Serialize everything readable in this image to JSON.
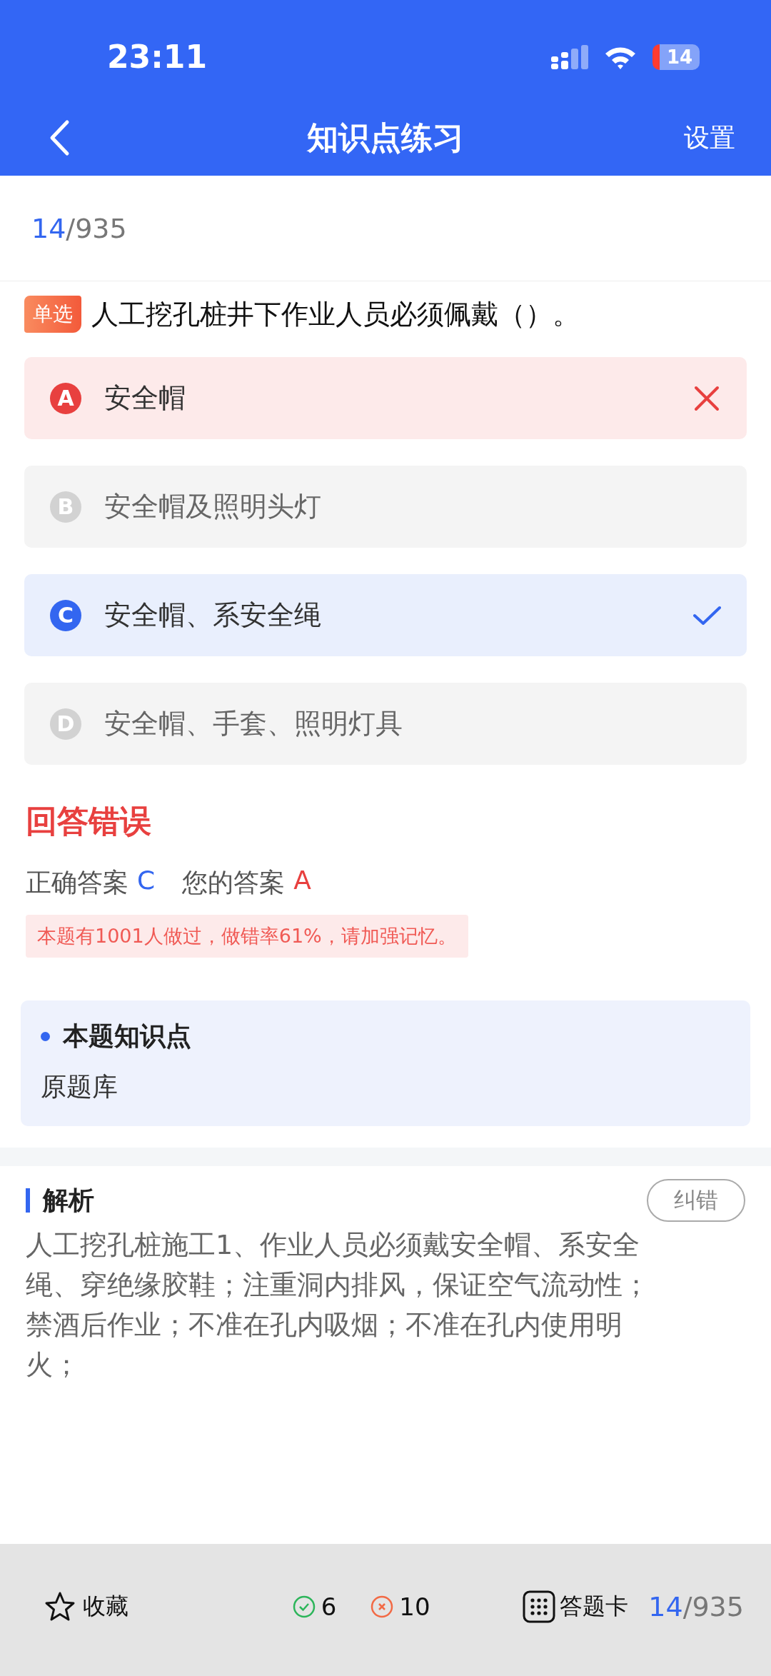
{
  "status_bar": {
    "time": "23:11",
    "battery": "14"
  },
  "nav": {
    "title": "知识点练习",
    "action": "设置"
  },
  "progress": {
    "current": "14",
    "total": "/935"
  },
  "question": {
    "type_tag": "单选",
    "text": "人工挖孔桩井下作业人员必须佩戴（）。"
  },
  "options": [
    {
      "letter": "A",
      "text": "安全帽",
      "kind": "wrong"
    },
    {
      "letter": "B",
      "text": "安全帽及照明头灯",
      "kind": "plain"
    },
    {
      "letter": "C",
      "text": "安全帽、系安全绳",
      "kind": "correct"
    },
    {
      "letter": "D",
      "text": "安全帽、手套、照明灯具",
      "kind": "plain"
    }
  ],
  "result": {
    "title": "回答错误",
    "correct_label": "正确答案",
    "correct_value": "C",
    "your_label": "您的答案",
    "your_value": "A",
    "hint": "本题有1001人做过，做错率61%，请加强记忆。"
  },
  "knowledge": {
    "title": "本题知识点",
    "value": "原题库"
  },
  "analysis": {
    "title": "解析",
    "button": "纠错",
    "text": "人工挖孔桩施工1、作业人员必须戴安全帽、系安全绳、穿绝缘胶鞋；注重洞内排风，保证空气流动性；禁酒后作业；不准在孔内吸烟；不准在孔内使用明火；"
  },
  "bottom_bar": {
    "favorite": "收藏",
    "right_count": "6",
    "wrong_count": "10",
    "card": "答题卡",
    "current": "14",
    "total": "/935"
  }
}
